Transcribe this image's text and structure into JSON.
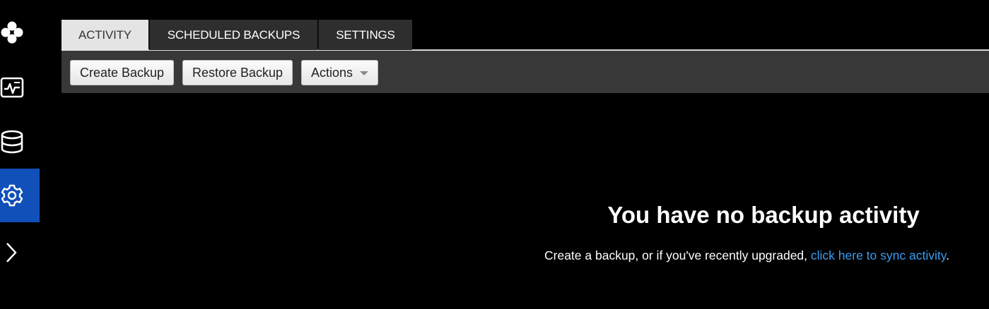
{
  "sidebar": {
    "items": [
      {
        "name": "logo-icon",
        "active": false
      },
      {
        "name": "monitor-icon",
        "active": false
      },
      {
        "name": "database-icon",
        "active": false
      },
      {
        "name": "gear-icon",
        "active": true
      },
      {
        "name": "chevron-right-icon",
        "active": false
      }
    ],
    "active_color": "#1050b8"
  },
  "tabs": {
    "activity": "ACTIVITY",
    "scheduled": "SCHEDULED BACKUPS",
    "settings": "SETTINGS",
    "active": "activity"
  },
  "toolbar": {
    "create_label": "Create Backup",
    "restore_label": "Restore Backup",
    "actions_label": "Actions"
  },
  "empty_state": {
    "title": "You have no backup activity",
    "message": "Create a backup, or if you've recently upgraded,",
    "link": "click here to sync activity",
    "trailing": ".",
    "link_color": "#3b9cf0"
  }
}
